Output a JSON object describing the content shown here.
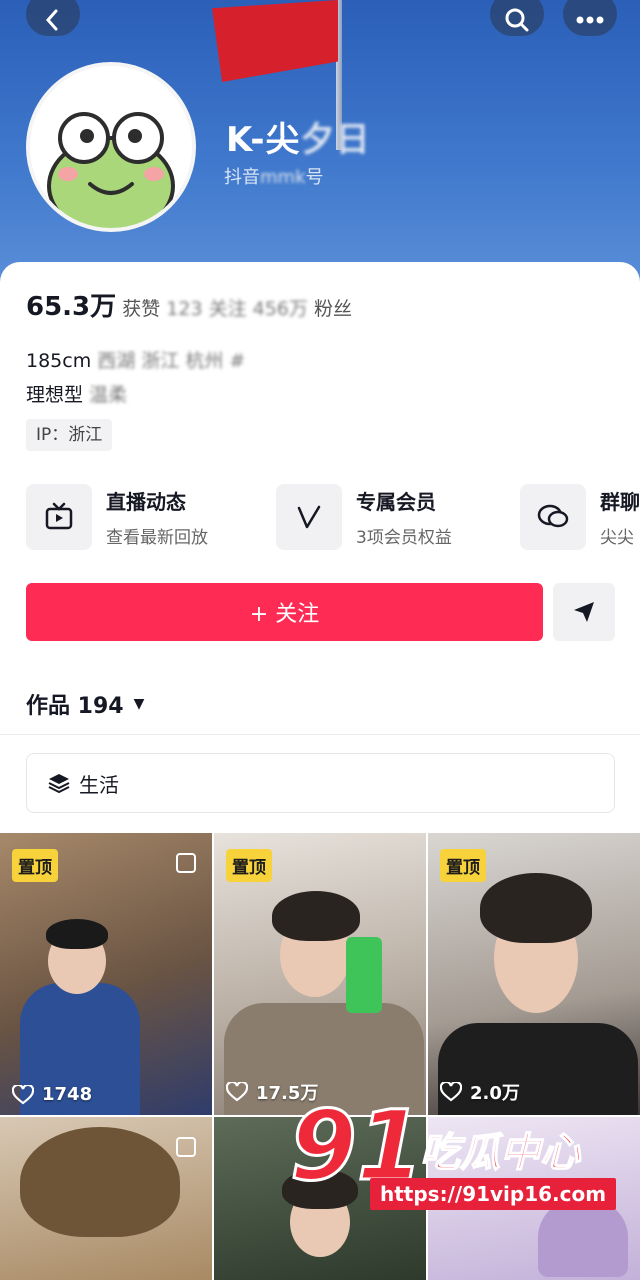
{
  "profile": {
    "name": "K-尖",
    "douyin_id_prefix": "抖音",
    "douyin_id_rest": "号"
  },
  "stats": {
    "likes_value": "65.3万",
    "likes_label": "获赞",
    "fans_label": "粉丝"
  },
  "bio": {
    "line1": "185cm",
    "line2": "理想型"
  },
  "ip": "IP：浙江",
  "features": [
    {
      "title": "直播动态",
      "subtitle": "查看最新回放",
      "icon": "tv-icon"
    },
    {
      "title": "专属会员",
      "subtitle": "3项会员权益",
      "icon": "v-icon"
    },
    {
      "title": "群聊",
      "subtitle": "尖尖",
      "icon": "chat-icon"
    }
  ],
  "follow_label": "+ 关注",
  "works_tab": {
    "label": "作品 194"
  },
  "collection_label": "生活",
  "videos": [
    {
      "pinned": "置顶",
      "likes": "1748"
    },
    {
      "pinned": "置顶",
      "likes": "17.5万"
    },
    {
      "pinned": "置顶",
      "likes": "2.0万"
    }
  ],
  "watermark": {
    "number": "91",
    "text": "吃瓜中心",
    "url": "https://91vip16.com"
  },
  "colors": {
    "accent": "#fe2c55",
    "header": "#3f78cc",
    "pin_badge": "#f8d23a"
  }
}
